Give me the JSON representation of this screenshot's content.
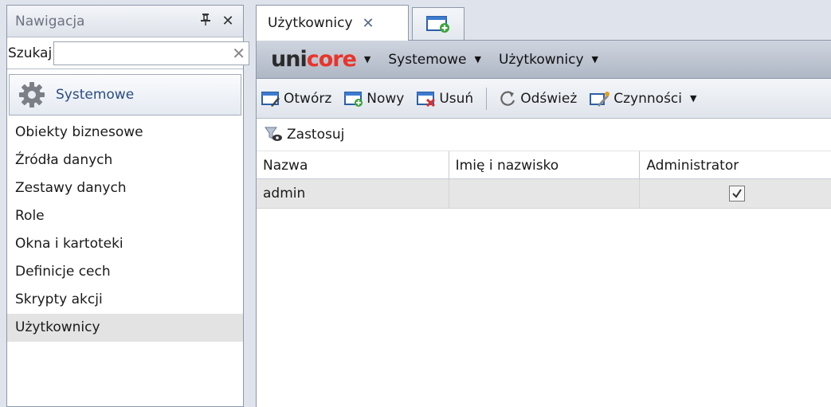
{
  "nav": {
    "title": "Nawigacja",
    "search_label": "Szukaj",
    "search_value": "",
    "group_label": "Systemowe",
    "items": [
      {
        "label": "Obiekty biznesowe"
      },
      {
        "label": "Źródła danych"
      },
      {
        "label": "Zestawy danych"
      },
      {
        "label": "Role"
      },
      {
        "label": "Okna i kartoteki"
      },
      {
        "label": "Definicje cech"
      },
      {
        "label": "Skrypty akcji"
      },
      {
        "label": "Użytkownicy",
        "selected": true
      }
    ]
  },
  "tabs": [
    {
      "label": "Użytkownicy",
      "active": true
    }
  ],
  "menubar": {
    "logo_part1": "uni",
    "logo_part2": "core",
    "items": [
      "Systemowe",
      "Użytkownicy"
    ]
  },
  "toolbar": {
    "open": "Otwórz",
    "new": "Nowy",
    "delete": "Usuń",
    "refresh": "Odśwież",
    "actions": "Czynności"
  },
  "filter": {
    "apply": "Zastosuj"
  },
  "grid": {
    "columns": [
      "Nazwa",
      "Imię i nazwisko",
      "Administrator"
    ],
    "rows": [
      {
        "name": "admin",
        "full_name": "",
        "admin": true
      }
    ]
  },
  "colors": {
    "accent_red": "#e8342b",
    "selected_row": "#e6e6e6",
    "menubar": "#aeb7c5"
  }
}
